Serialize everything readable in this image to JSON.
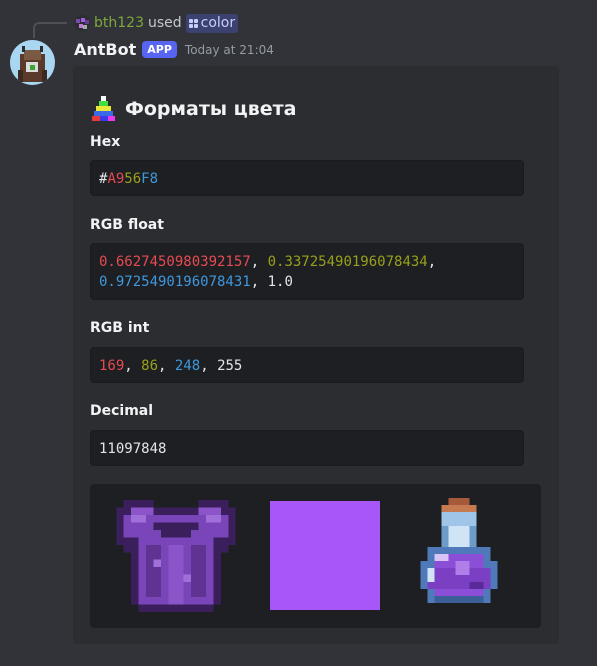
{
  "reply": {
    "username": "bth123",
    "used_text": "used",
    "command": "color"
  },
  "message": {
    "username": "AntBot",
    "app_tag": "APP",
    "timestamp": "Today at 21:04"
  },
  "embed": {
    "title": "Форматы цвета",
    "fields": {
      "hex": {
        "name": "Hex",
        "hash": "#",
        "r": "A9",
        "g": "56",
        "b": "F8"
      },
      "rgb_float": {
        "name": "RGB float",
        "r": "0.6627450980392157",
        "g": "0.33725490196078434",
        "b": "0.9725490196078431",
        "a": "1.0",
        "sep": ","
      },
      "rgb_int": {
        "name": "RGB int",
        "r": "169",
        "g": "86",
        "b": "248",
        "a": "255",
        "sep": ","
      },
      "decimal": {
        "name": "Decimal",
        "value": "11097848"
      }
    },
    "color_swatch": "#A956F8",
    "images": [
      "chestplate-icon",
      "color-swatch",
      "potion-icon"
    ]
  },
  "colors": {
    "background": "#313338",
    "embed_bg": "#2b2d31",
    "code_bg": "#1e1f22",
    "app_tag": "#5865f2",
    "red": "#e64b52",
    "olive": "#98a019",
    "blue": "#3e98dd"
  }
}
